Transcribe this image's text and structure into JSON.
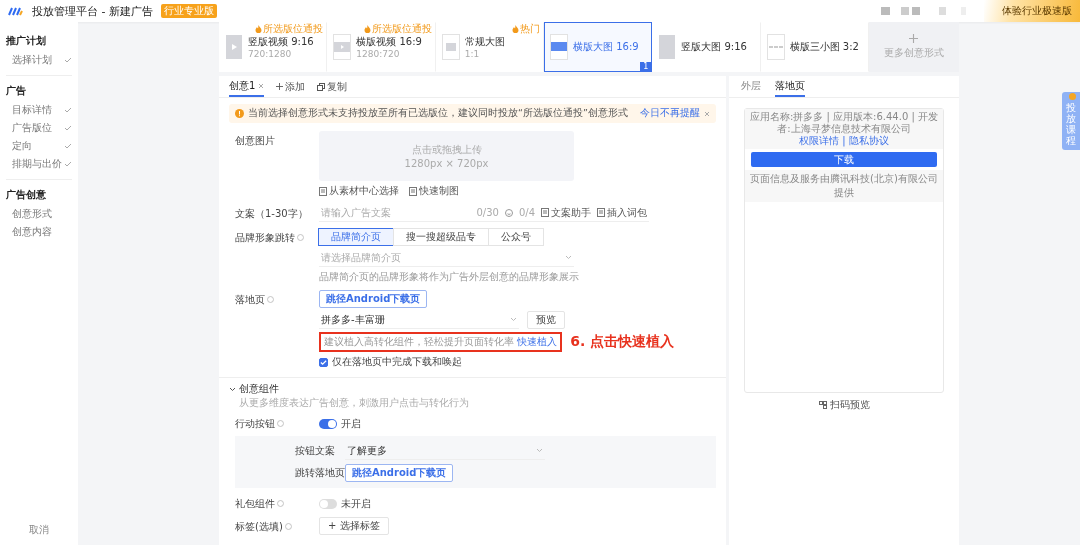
{
  "header": {
    "title": "投放管理平台 - 新建广告",
    "badge": "行业专业版",
    "upgrade_button": "体验行业极速版"
  },
  "sidebar": {
    "groups": [
      {
        "title": "推广计划",
        "items": [
          {
            "label": "选择计划",
            "done": true
          }
        ]
      },
      {
        "title": "广告",
        "items": [
          {
            "label": "目标详情",
            "done": true
          },
          {
            "label": "广告版位",
            "done": true
          },
          {
            "label": "定向",
            "done": true
          },
          {
            "label": "排期与出价",
            "done": true
          }
        ]
      },
      {
        "title": "广告创意",
        "items": [
          {
            "label": "创意形式",
            "done": false
          },
          {
            "label": "创意内容",
            "done": false
          }
        ]
      }
    ],
    "cancel": "取消"
  },
  "formats": {
    "items": [
      {
        "kind": "vertical_video",
        "name": "竖版视频 9:16",
        "size": "720:1280",
        "tag": "所选版位通投",
        "selected": false
      },
      {
        "kind": "horizontal_video",
        "name": "横版视频 16:9",
        "size": "1280:720",
        "tag": "所选版位通投",
        "selected": false
      },
      {
        "kind": "square_image",
        "name": "常规大图",
        "size": "1:1",
        "tag": "热门",
        "selected": false
      },
      {
        "kind": "wide_image",
        "name": "横版大图 16:9",
        "count": "1",
        "selected": true
      },
      {
        "kind": "tall_image",
        "name": "竖版大图 9:16",
        "selected": false
      },
      {
        "kind": "three_images",
        "name": "横版三小图 3:2",
        "selected": false
      }
    ],
    "more": "更多创意形式"
  },
  "creative_tabs": {
    "tabs": [
      {
        "label": "创意1",
        "selected": true
      }
    ],
    "add": "添加",
    "copy": "复制"
  },
  "alert": {
    "text": "当前选择创意形式未支持投放至所有已选版位，建议同时投放“所选版位通投”创意形式",
    "dismiss": "今日不再提醒"
  },
  "image_field": {
    "label": "创意图片",
    "upload_text": "点击或拖拽上传",
    "upload_size": "1280px × 720px",
    "links": [
      "从素材中心选择",
      "快速制图"
    ]
  },
  "copy_field": {
    "label": "文案（1-30字）",
    "placeholder": "请输入广告文案",
    "counter": "0/30",
    "emoji_counter": "0/4",
    "tools": [
      "文案助手",
      "插入词包"
    ]
  },
  "brand_field": {
    "label": "品牌形象跳转",
    "options": [
      {
        "label": "品牌简介页",
        "selected": true
      },
      {
        "label": "搜一搜超级品专",
        "selected": false
      },
      {
        "label": "公众号",
        "selected": false
      }
    ],
    "placeholder": "请选择品牌简介页",
    "hint": "品牌简介页的品牌形象将作为广告外层创意的品牌形象展示"
  },
  "landing_field": {
    "label": "落地页",
    "button": "跳径Android下载页",
    "value": "拼多多-丰富珊",
    "preview_button": "预览",
    "hint": "建议植入高转化组件，轻松提升页面转化率",
    "hint_link": "快速植入",
    "checkbox": {
      "label": "仅在落地页中完成下载和唤起",
      "checked": true
    }
  },
  "annotation": "6. 点击快速植入",
  "components": {
    "title": "创意组件",
    "expanded": true,
    "description": "从更多维度表达广告创意，刺激用户点击与转化行为",
    "action_button": {
      "label": "行动按钮",
      "on": true,
      "state_text": "开启",
      "text_label": "按钮文案",
      "text_value": "了解更多",
      "jump_label": "跳转落地页",
      "jump_button": "跳径Android下载页"
    },
    "gift": {
      "label": "礼包组件",
      "on": false,
      "state_text": "未开启"
    },
    "tags": {
      "label": "标签(选填)",
      "button": "+ 选择标签"
    }
  },
  "preview": {
    "tabs": [
      {
        "label": "外层",
        "selected": false
      },
      {
        "label": "落地页",
        "selected": true
      }
    ],
    "app_info": "应用名称:拼多多 | 应用版本:6.44.0 | 开发者:上海寻梦信息技术有限公司",
    "app_links": "权限详情 | 隐私协议",
    "download_button": "下载",
    "footer": "页面信息及服务由腾讯科技(北京)有限公司提供",
    "qr_label": "扫码预览"
  },
  "side_tab": "投放课程"
}
